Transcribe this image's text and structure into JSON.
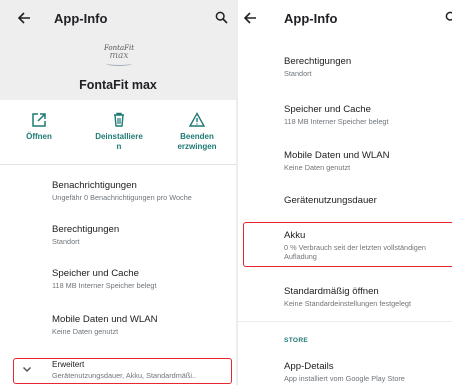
{
  "left_screen": {
    "app_bar": {
      "title": "App-Info",
      "back_icon": "arrow-back-icon",
      "search_icon": "search-icon"
    },
    "app_header": {
      "logo_text_line1": "FontaFit",
      "logo_text_line2": "max",
      "app_name": "FontaFit max"
    },
    "actions": [
      {
        "label": "Öffnen",
        "icon": "open-in-new-icon"
      },
      {
        "label": "Deinstalliere\nn",
        "icon": "trash-icon"
      },
      {
        "label": "Beenden\nerzwingen",
        "icon": "warning-triangle-icon"
      }
    ],
    "settings": [
      {
        "title": "Benachrichtigungen",
        "subtitle": "Ungefähr 0 Benachrichtigungen pro Woche"
      },
      {
        "title": "Berechtigungen",
        "subtitle": "Standort"
      },
      {
        "title": "Speicher und Cache",
        "subtitle": "118 MB Interner Speicher belegt"
      },
      {
        "title": "Mobile Daten und WLAN",
        "subtitle": "Keine Daten genutzt"
      }
    ],
    "advanced": {
      "title": "Erweitert",
      "subtitle": "Gerätenutzungsdauer, Akku, Standardmäßi..",
      "icon": "chevron-down-icon"
    }
  },
  "right_screen": {
    "app_bar": {
      "title": "App-Info",
      "back_icon": "arrow-back-icon",
      "search_icon": "search-icon"
    },
    "settings": [
      {
        "title": "Berechtigungen",
        "subtitle": "Standort"
      },
      {
        "title": "Speicher und Cache",
        "subtitle": "118 MB Interner Speicher belegt"
      },
      {
        "title": "Mobile Daten und WLAN",
        "subtitle": "Keine Daten genutzt"
      },
      {
        "title": "Gerätenutzungsdauer",
        "subtitle": ""
      },
      {
        "title": "Akku",
        "subtitle": "0 % Verbrauch seit der letzten vollständigen",
        "subtitle2": "Aufladung"
      },
      {
        "title": "Standardmäßig öffnen",
        "subtitle": "Keine Standardeinstellungen festgelegt"
      }
    ],
    "store_section": "STORE",
    "app_details": {
      "title": "App-Details",
      "subtitle": "App installiert vom Google Play Store"
    }
  },
  "colors": {
    "accent": "#1f7a74",
    "highlight_box": "#e8262d",
    "header_background": "#eeeeee"
  }
}
